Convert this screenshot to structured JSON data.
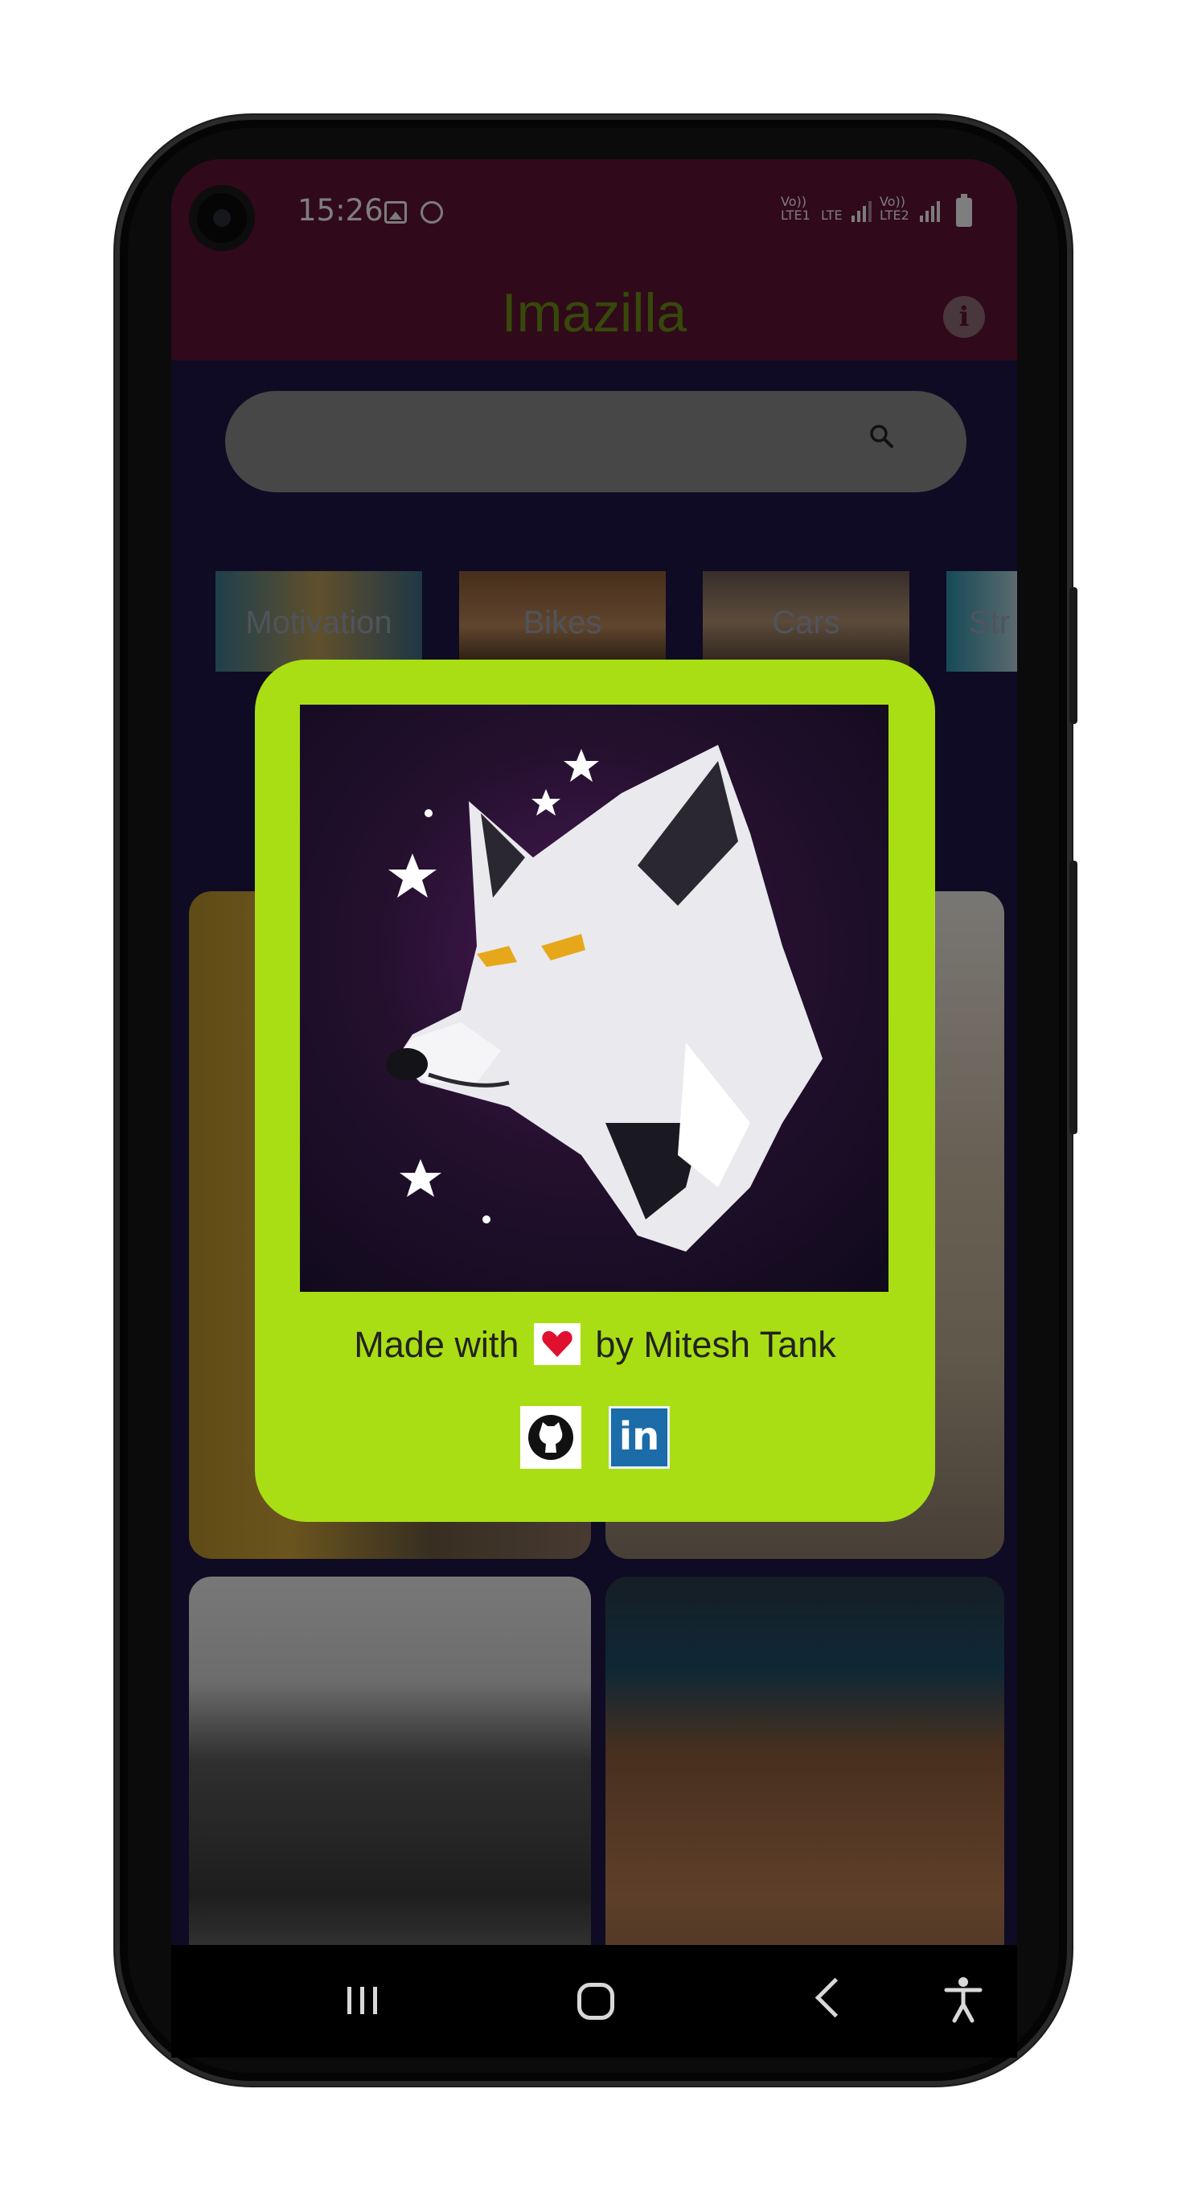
{
  "status_bar": {
    "time": "15:26",
    "sim1_label": "Vo)) LTE1",
    "network1_label": "LTE",
    "sim2_label": "Vo)) LTE2"
  },
  "app": {
    "title": "Imazilla",
    "title_color": "#6a8a14",
    "bar_color": "#5c1432"
  },
  "search": {
    "placeholder": ""
  },
  "categories": [
    {
      "label": "Motivation"
    },
    {
      "label": "Bikes"
    },
    {
      "label": "Cars"
    },
    {
      "label": "Str"
    }
  ],
  "dialog": {
    "background": "#aade14",
    "credit_prefix": "Made with",
    "credit_suffix": "by Mitesh Tank",
    "links": [
      {
        "name": "github",
        "icon": "github-icon"
      },
      {
        "name": "linkedin",
        "icon": "linkedin-icon",
        "text": "in"
      }
    ]
  },
  "nav": {
    "items": [
      "recents",
      "home",
      "back",
      "accessibility"
    ]
  }
}
